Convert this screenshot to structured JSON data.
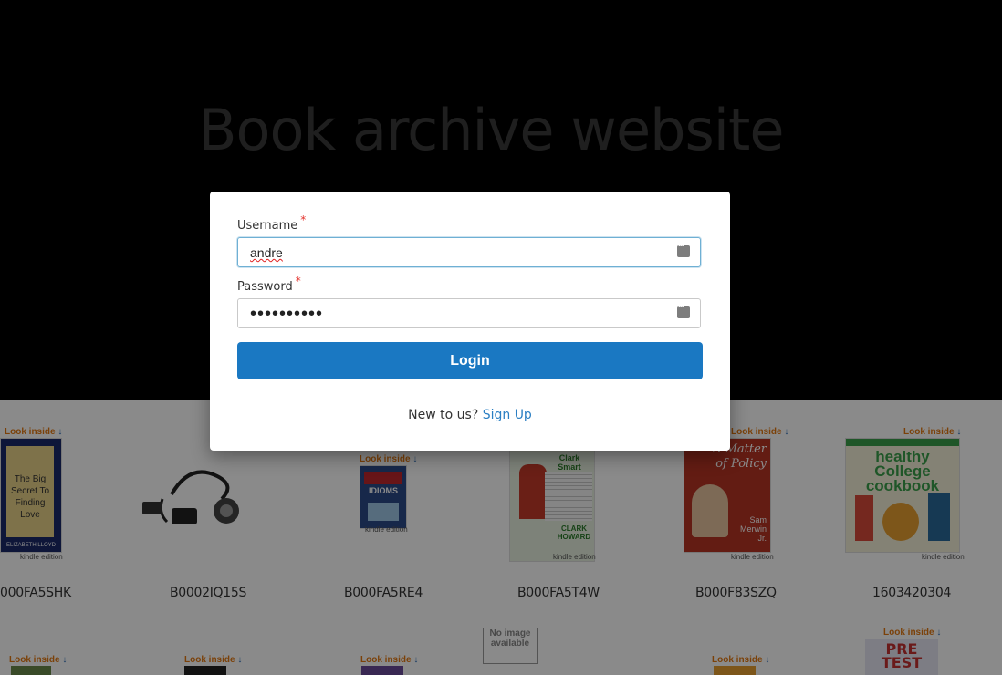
{
  "hero": {
    "title": "Book archive website"
  },
  "products": [
    {
      "asin": "000FA5SHK",
      "look_inside": "Look inside",
      "edition": "kindle edition",
      "cover_text": "The Big Secret To Finding Love",
      "cover_author": "ELIZABETH LLOYD",
      "cover_color": "#1a2a6a"
    },
    {
      "asin": "B0002IQ15S",
      "cover_color": "#222222"
    },
    {
      "asin": "B000FA5RE4",
      "look_inside": "Look inside",
      "edition": "kindle edition",
      "cover_text": "IDIOMS",
      "cover_color": "#2c4a8a"
    },
    {
      "asin": "B000FA5T4W",
      "edition": "kindle edition",
      "cover_text": "Clark Smart",
      "cover_author": "CLARK HOWARD",
      "cover_color": "#e8f0e0"
    },
    {
      "asin": "B000F83SZQ",
      "look_inside": "Look inside",
      "edition": "kindle edition",
      "cover_text": "A Matter of Policy",
      "cover_author": "Sam Merwin Jr.",
      "cover_color": "#b83424"
    },
    {
      "asin": "1603420304",
      "look_inside": "Look inside",
      "edition": "kindle edition",
      "cover_text": "healthy College cookbook",
      "cover_color": "#3aa04a"
    }
  ],
  "second_row": {
    "no_image": "No image available",
    "pretest_text": "PRE TEST",
    "look_inside": "Look inside"
  },
  "login": {
    "username_label": "Username",
    "username_value": "andre",
    "password_label": "Password",
    "password_value": "••••••••••",
    "required_mark": "*",
    "login_button": "Login",
    "new_prompt": "New to us?",
    "signup_link": "Sign Up"
  },
  "colors": {
    "primary": "#1a78c2",
    "link": "#2b7fc3",
    "required": "#e4332d",
    "hero_bg": "#000000"
  }
}
